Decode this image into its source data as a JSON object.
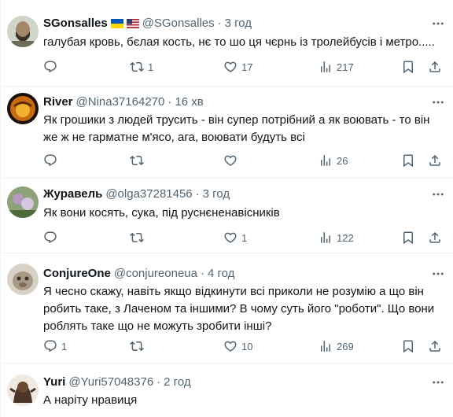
{
  "replies": [
    {
      "name": "SGonsalles",
      "flags": [
        "ukraine-flag-icon",
        "usa-flag-icon"
      ],
      "handle": "@SGonsalles",
      "dot": "·",
      "time": "3 год",
      "text": "галубая кровь, бєлая кость, нє то шо ця чєрнь із тролейбусів і метро.....",
      "reply_count": "",
      "retweet_count": "1",
      "like_count": "17",
      "view_count": "217"
    },
    {
      "name": "River",
      "handle": "@Nina37164270",
      "dot": "·",
      "time": "16 хв",
      "text": "Як грошики з людей трусить - він супер потрібний а як воювать -  то він\nже ж не гарматне м'ясо, ага, воювати будуть всі",
      "reply_count": "",
      "retweet_count": "",
      "like_count": "",
      "view_count": "26"
    },
    {
      "name": "Журавель",
      "handle": "@olga37281456",
      "dot": "·",
      "time": "3 год",
      "text": "Як вони косять, сука, під руснєненавісників",
      "reply_count": "",
      "retweet_count": "",
      "like_count": "1",
      "view_count": "122"
    },
    {
      "name": "ConjureOne",
      "handle": "@conjureoneua",
      "dot": "·",
      "time": "4 год",
      "text": "Я чесно скажу, навіть якщо відкинути всі приколи не розумію а що він\nробить таке, з Лаченом та іншими? В чому суть його \"роботи\". Що вони\nроблять таке що не можуть зробити інші?",
      "reply_count": "1",
      "retweet_count": "",
      "like_count": "10",
      "view_count": "269"
    },
    {
      "name": "Yuri",
      "handle": "@Yuri57048376",
      "dot": "·",
      "time": "2 год",
      "text": "А наріту нравиця",
      "reply_count": "",
      "retweet_count": "",
      "like_count": "",
      "view_count": ""
    }
  ],
  "colors": {
    "text": "#0f1419",
    "secondary": "#536471",
    "divider": "#eff3f4"
  }
}
